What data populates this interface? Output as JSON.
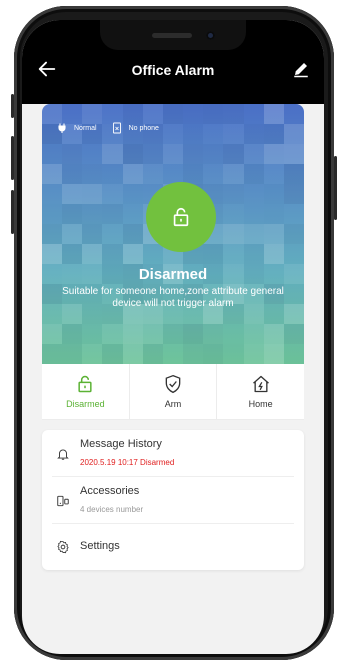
{
  "header": {
    "title": "Office Alarm",
    "back_icon": "arrow-left-icon",
    "edit_icon": "pencil-icon"
  },
  "banner": {
    "power_status": "Normal",
    "phone_status": "No phone",
    "state_title": "Disarmed",
    "state_desc": "Suitable for someone home,zone attribute general device will not trigger alarm",
    "lock_icon": "unlock-icon",
    "accent_color": "#72c13e"
  },
  "modes": [
    {
      "label": "Disarmed",
      "icon": "unlock-icon",
      "active": true
    },
    {
      "label": "Arm",
      "icon": "shield-check-icon",
      "active": false
    },
    {
      "label": "Home",
      "icon": "home-bolt-icon",
      "active": false
    }
  ],
  "list": {
    "message_history": {
      "title": "Message History",
      "subtitle": "2020.5.19 10:17 Disarmed",
      "icon": "bell-icon"
    },
    "accessories": {
      "title": "Accessories",
      "subtitle": "4 devices number",
      "icon": "devices-icon"
    },
    "settings": {
      "title": "Settings",
      "icon": "gear-icon"
    }
  },
  "colors": {
    "active_green": "#5bb234",
    "alert_red": "#e02020"
  }
}
